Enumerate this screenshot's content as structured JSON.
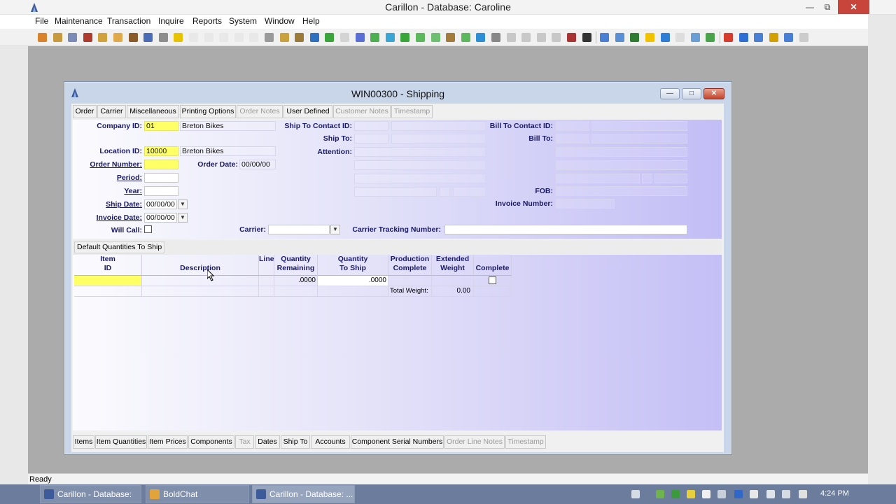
{
  "app": {
    "title": "Carillon - Database: Caroline",
    "menu": [
      "File",
      "Maintenance",
      "Transaction",
      "Inquire",
      "Reports",
      "System",
      "Window",
      "Help"
    ],
    "status": "Ready"
  },
  "window": {
    "title": "WIN00300 - Shipping",
    "top_tabs": [
      "Order",
      "Carrier",
      "Miscellaneous",
      "Printing Options",
      "Order Notes",
      "User Defined",
      "Customer Notes",
      "Timestamp"
    ],
    "bottom_tabs": [
      "Items",
      "Item Quantities",
      "Item Prices",
      "Components",
      "Tax",
      "Dates",
      "Ship To",
      "Accounts",
      "Component Serial Numbers",
      "Order Line Notes",
      "Timestamp"
    ]
  },
  "form": {
    "company_id_label": "Company ID:",
    "company_id": "01",
    "company_name": "Breton Bikes",
    "location_id_label": "Location ID:",
    "location_id": "10000",
    "location_name": "Breton Bikes",
    "order_number_label": "Order Number:",
    "order_number": "",
    "order_date_label": "Order Date:",
    "order_date": "00/00/00",
    "period_label": "Period:",
    "year_label": "Year:",
    "ship_date_label": "Ship Date:",
    "ship_date": "00/00/00",
    "invoice_date_label": "Invoice Date:",
    "invoice_date": "00/00/00",
    "will_call_label": "Will Call:",
    "carrier_label": "Carrier:",
    "carrier_tracking_label": "Carrier Tracking Number:",
    "ship_to_contact_label": "Ship To Contact ID:",
    "ship_to_label": "Ship To:",
    "attention_label": "Attention:",
    "bill_to_contact_label": "Bill To Contact ID:",
    "bill_to_label": "Bill To:",
    "fob_label": "FOB:",
    "invoice_number_label": "Invoice Number:"
  },
  "grid": {
    "section_button": "Default Quantities To Ship",
    "headers": [
      {
        "l1": "Item",
        "l2": "ID"
      },
      {
        "l1": "",
        "l2": "Description"
      },
      {
        "l1": "Line",
        "l2": ""
      },
      {
        "l1": "Quantity",
        "l2": "Remaining"
      },
      {
        "l1": "Quantity",
        "l2": "To Ship"
      },
      {
        "l1": "Production",
        "l2": "Complete"
      },
      {
        "l1": "Extended",
        "l2": "Weight"
      },
      {
        "l1": "",
        "l2": "Complete"
      }
    ],
    "row": {
      "qty_remaining": ".0000",
      "qty_to_ship": ".0000"
    },
    "total_weight_label": "Total Weight:",
    "total_weight": "0.00"
  },
  "taskbar": {
    "tasks": [
      "Carillon - Database: ...",
      "BoldChat",
      "Carillon - Database: ..."
    ],
    "time": "4:24 PM"
  }
}
